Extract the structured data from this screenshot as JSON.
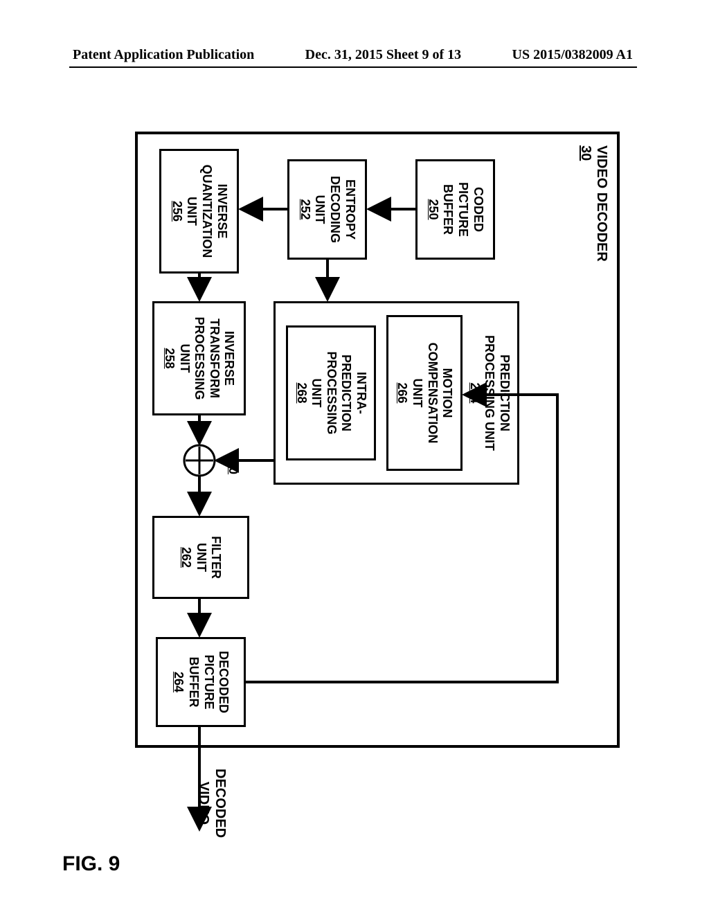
{
  "header": {
    "left": "Patent Application Publication",
    "mid": "Dec. 31, 2015  Sheet 9 of 13",
    "right": "US 2015/0382009 A1"
  },
  "figure_caption": "FIG. 9",
  "decoder": {
    "title": "VIDEO DECODER",
    "ref": "30"
  },
  "blocks": {
    "cpb": {
      "l1": "CODED",
      "l2": "PICTURE",
      "l3": "BUFFER",
      "ref": "250"
    },
    "ent": {
      "l1": "ENTROPY",
      "l2": "DECODING",
      "l3": "UNIT",
      "ref": "252"
    },
    "iq": {
      "l1": "INVERSE",
      "l2": "QUANTIZATION",
      "l3": "UNIT",
      "ref": "256"
    },
    "itp": {
      "l1": "INVERSE",
      "l2": "TRANSFORM",
      "l3": "PROCESSING",
      "l4": "UNIT",
      "ref": "258"
    },
    "ppu": {
      "l1": "PREDICTION",
      "l2": "PROCESSING UNIT",
      "ref": "254"
    },
    "mc": {
      "l1": "MOTION",
      "l2": "COMPENSATION",
      "l3": "UNIT",
      "ref": "266"
    },
    "intra": {
      "l1": "INTRA-",
      "l2": "PREDICTION",
      "l3": "PROCESSING",
      "l4": "UNIT",
      "ref": "268"
    },
    "filter": {
      "l1": "FILTER",
      "l2": "UNIT",
      "ref": "262"
    },
    "dpb": {
      "l1": "DECODED",
      "l2": "PICTURE",
      "l3": "BUFFER",
      "ref": "264"
    }
  },
  "adder_ref": "260",
  "output": {
    "l1": "DECODED",
    "l2": "VIDEO"
  },
  "chart_data": {
    "type": "block-diagram",
    "title": "VIDEO DECODER 30",
    "nodes": [
      {
        "id": "cpb",
        "label": "CODED PICTURE BUFFER",
        "ref": "250"
      },
      {
        "id": "ent",
        "label": "ENTROPY DECODING UNIT",
        "ref": "252"
      },
      {
        "id": "iq",
        "label": "INVERSE QUANTIZATION UNIT",
        "ref": "256"
      },
      {
        "id": "itp",
        "label": "INVERSE TRANSFORM PROCESSING UNIT",
        "ref": "258"
      },
      {
        "id": "ppu",
        "label": "PREDICTION PROCESSING UNIT",
        "ref": "254"
      },
      {
        "id": "mc",
        "label": "MOTION COMPENSATION UNIT",
        "ref": "266",
        "parent": "ppu"
      },
      {
        "id": "intra",
        "label": "INTRA-PREDICTION PROCESSING UNIT",
        "ref": "268",
        "parent": "ppu"
      },
      {
        "id": "adder",
        "label": "SUMMER",
        "ref": "260"
      },
      {
        "id": "filter",
        "label": "FILTER UNIT",
        "ref": "262"
      },
      {
        "id": "dpb",
        "label": "DECODED PICTURE BUFFER",
        "ref": "264"
      },
      {
        "id": "out",
        "label": "DECODED VIDEO"
      }
    ],
    "edges": [
      {
        "from": "cpb",
        "to": "ent"
      },
      {
        "from": "ent",
        "to": "iq"
      },
      {
        "from": "ent",
        "to": "ppu"
      },
      {
        "from": "iq",
        "to": "itp"
      },
      {
        "from": "itp",
        "to": "adder"
      },
      {
        "from": "ppu",
        "to": "adder"
      },
      {
        "from": "adder",
        "to": "filter"
      },
      {
        "from": "filter",
        "to": "dpb"
      },
      {
        "from": "dpb",
        "to": "mc"
      },
      {
        "from": "dpb",
        "to": "out"
      }
    ]
  }
}
